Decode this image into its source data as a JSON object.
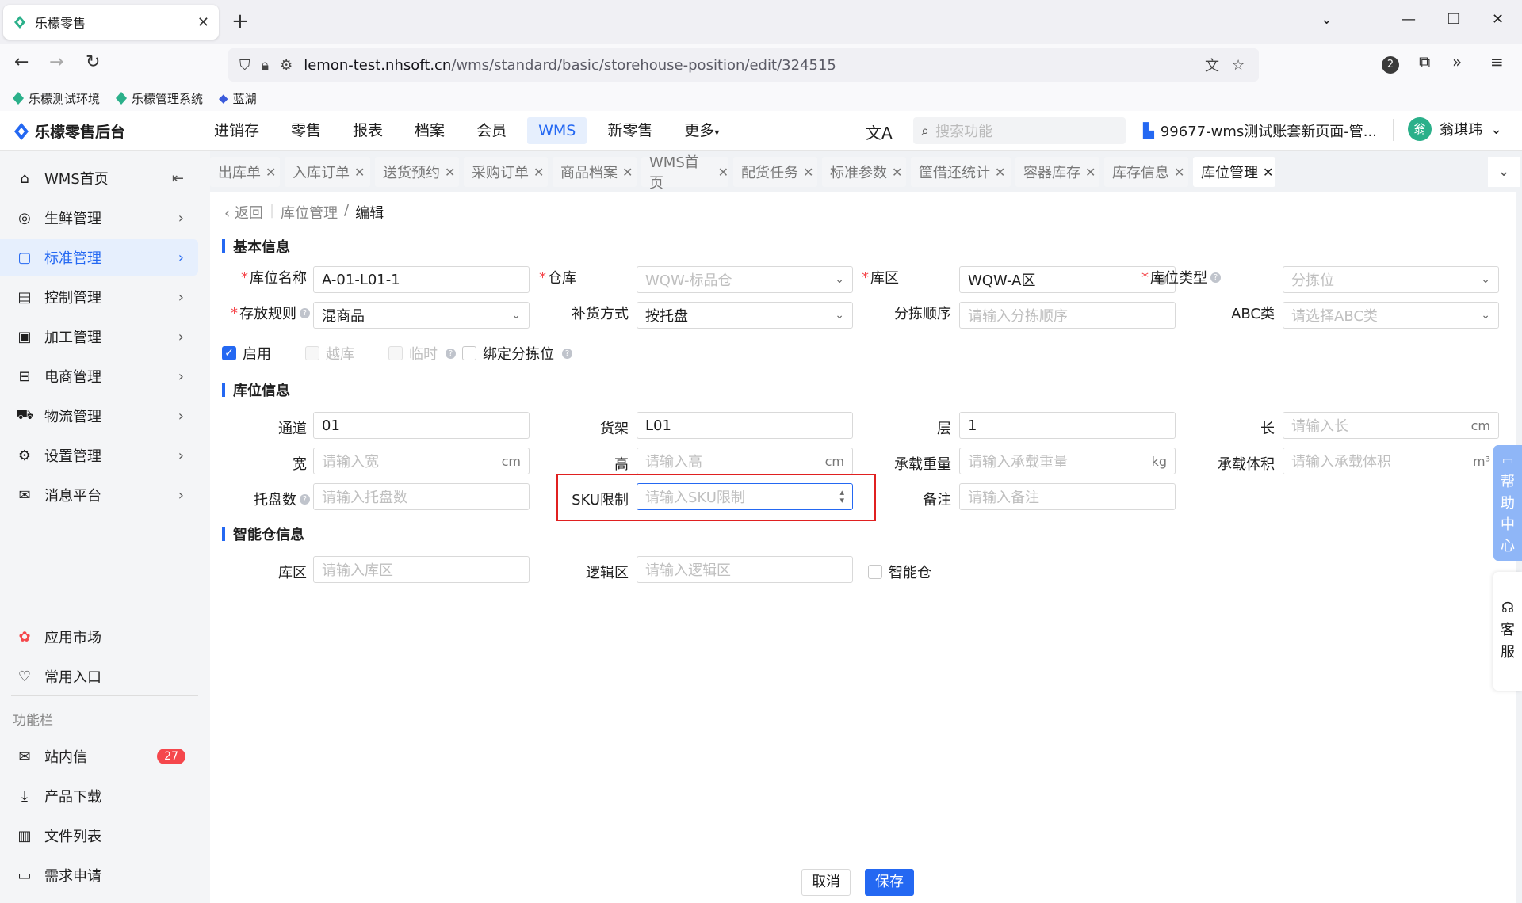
{
  "browser": {
    "tab_title": "乐檬零售",
    "url_host": "lemon-test.nhsoft.cn",
    "url_path": "/wms/standard/basic/storehouse-position/edit/324515",
    "ext_badge": "2",
    "bookmarks": [
      "乐檬测试环境",
      "乐檬管理系统",
      "蓝湖"
    ]
  },
  "header": {
    "logo": "乐檬零售后台",
    "nav": [
      "进销存",
      "零售",
      "报表",
      "档案",
      "会员",
      "WMS",
      "新零售",
      "更多"
    ],
    "active_nav": "WMS",
    "search_placeholder": "搜索功能",
    "tenant": "99677-wms测试账套新页面-管...",
    "avatar_text": "翁",
    "user_name": "翁琪玮"
  },
  "sidebar": {
    "items": [
      {
        "label": "WMS首页",
        "icon": "home-icon"
      },
      {
        "label": "生鲜管理",
        "icon": "fresh-icon"
      },
      {
        "label": "标准管理",
        "icon": "standard-icon"
      },
      {
        "label": "控制管理",
        "icon": "control-icon"
      },
      {
        "label": "加工管理",
        "icon": "process-icon"
      },
      {
        "label": "电商管理",
        "icon": "ecommerce-icon"
      },
      {
        "label": "物流管理",
        "icon": "logistics-icon"
      },
      {
        "label": "设置管理",
        "icon": "settings-icon"
      },
      {
        "label": "消息平台",
        "icon": "message-icon"
      }
    ],
    "bottom": {
      "app_market": "应用市场",
      "common_entry": "常用入口",
      "group_label": "功能栏",
      "inbox": "站内信",
      "inbox_count": "27",
      "download": "产品下载",
      "files": "文件列表",
      "request": "需求申请"
    }
  },
  "page_tabs": [
    "出库单",
    "入库订单",
    "送货预约",
    "采购订单",
    "商品档案",
    "WMS首页",
    "配货任务",
    "标准参数",
    "筐借还统计",
    "容器库存",
    "库存信息",
    "库位管理"
  ],
  "breadcrumb": {
    "back": "返回",
    "parent": "库位管理",
    "current": "编辑"
  },
  "sections": {
    "basic": "基本信息",
    "position": "库位信息",
    "smart": "智能仓信息"
  },
  "basic": {
    "position_name_label": "库位名称",
    "position_name": "A-01-L01-1",
    "warehouse_label": "仓库",
    "warehouse": "WQW-标品仓",
    "zone_label": "库区",
    "zone": "WQW-A区",
    "position_type_label": "库位类型",
    "position_type": "分拣位",
    "storage_rule_label": "存放规则",
    "storage_rule": "混商品",
    "replenish_label": "补货方式",
    "replenish": "按托盘",
    "pick_order_label": "分拣顺序",
    "pick_order_ph": "请输入分拣顺序",
    "abc_label": "ABC类",
    "abc_ph": "请选择ABC类",
    "enable": "启用",
    "cross": "越库",
    "temp": "临时",
    "bind_pick": "绑定分拣位"
  },
  "position": {
    "aisle_label": "通道",
    "aisle": "01",
    "shelf_label": "货架",
    "shelf": "L01",
    "layer_label": "层",
    "layer": "1",
    "length_label": "长",
    "length_ph": "请输入长",
    "length_unit": "cm",
    "width_label": "宽",
    "width_ph": "请输入宽",
    "width_unit": "cm",
    "height_label": "高",
    "height_ph": "请输入高",
    "height_unit": "cm",
    "weight_label": "承载重量",
    "weight_ph": "请输入承载重量",
    "weight_unit": "kg",
    "volume_label": "承载体积",
    "volume_ph": "请输入承载体积",
    "volume_unit": "m³",
    "pallet_label": "托盘数",
    "pallet_ph": "请输入托盘数",
    "sku_label": "SKU限制",
    "sku_ph": "请输入SKU限制",
    "remark_label": "备注",
    "remark_ph": "请输入备注"
  },
  "smart": {
    "zone_label": "库区",
    "zone_ph": "请输入库区",
    "logic_label": "逻辑区",
    "logic_ph": "请输入逻辑区",
    "smart_label": "智能仓"
  },
  "buttons": {
    "cancel": "取消",
    "save": "保存"
  },
  "help": {
    "help_center": [
      "帮",
      "助",
      "中",
      "心"
    ],
    "service": [
      "客",
      "服"
    ]
  }
}
